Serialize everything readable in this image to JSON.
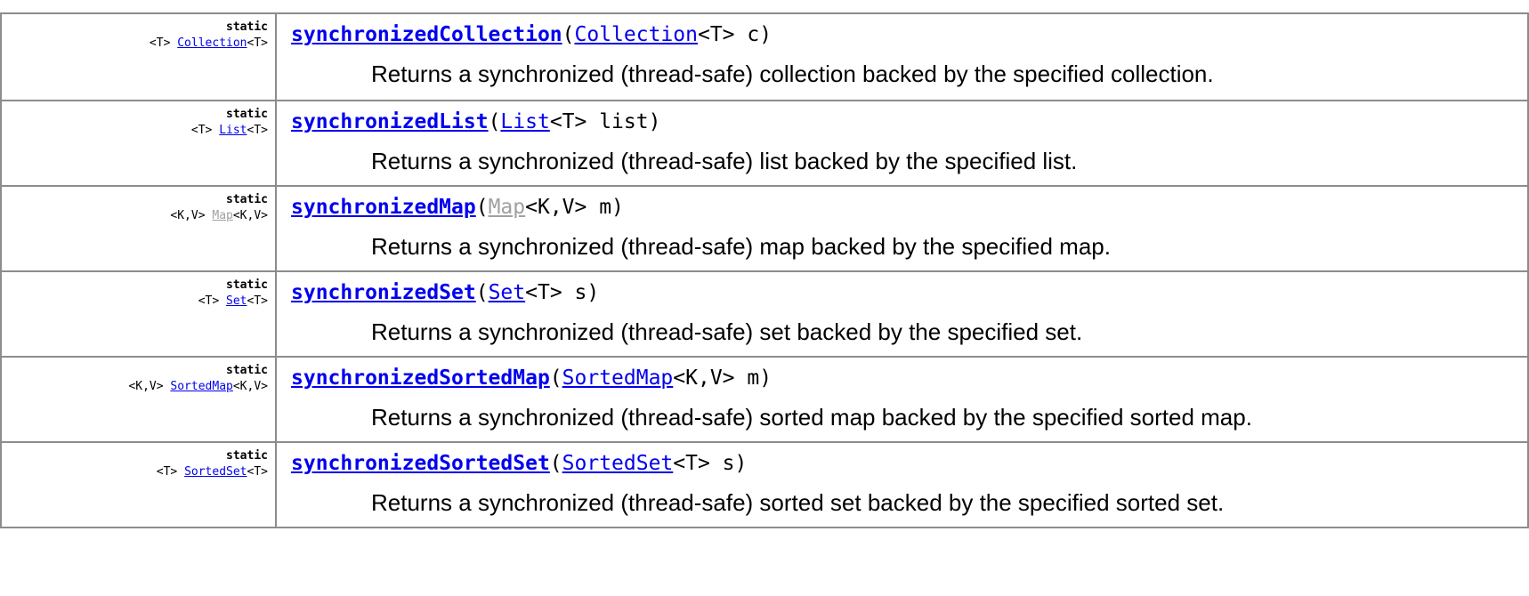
{
  "rows": [
    {
      "modifier": "static",
      "type_params": "<T>",
      "return_type": "Collection",
      "return_generics": "<T>",
      "method": "synchronizedCollection",
      "param_open": "(",
      "param_type": "Collection",
      "param_rest": "<T> c)",
      "description": "Returns a synchronized (thread-safe) collection backed by the specified collection."
    },
    {
      "modifier": "static",
      "type_params": "<T>",
      "return_type": "List",
      "return_generics": "<T>",
      "method": "synchronizedList",
      "param_open": "(",
      "param_type": "List",
      "param_rest": "<T> list)",
      "description": "Returns a synchronized (thread-safe) list backed by the specified list."
    },
    {
      "modifier": "static",
      "type_params": "<K,V>",
      "return_type": "Map",
      "return_generics": "<K,V>",
      "method": "synchronizedMap",
      "param_open": "(",
      "param_type": "Map",
      "param_rest": "<K,V> m)",
      "description": "Returns a synchronized (thread-safe) map backed by the specified map."
    },
    {
      "modifier": "static",
      "type_params": "<T>",
      "return_type": "Set",
      "return_generics": "<T>",
      "method": "synchronizedSet",
      "param_open": "(",
      "param_type": "Set",
      "param_rest": "<T> s)",
      "description": "Returns a synchronized (thread-safe) set backed by the specified set."
    },
    {
      "modifier": "static",
      "type_params": "<K,V>",
      "return_type": "SortedMap",
      "return_generics": "<K,V>",
      "method": "synchronizedSortedMap",
      "param_open": "(",
      "param_type": "SortedMap",
      "param_rest": "<K,V> m)",
      "description": "Returns a synchronized (thread-safe) sorted map backed by the specified sorted map."
    },
    {
      "modifier": "static",
      "type_params": "<T>",
      "return_type": "SortedSet",
      "return_generics": "<T>",
      "method": "synchronizedSortedSet",
      "param_open": "(",
      "param_type": "SortedSet",
      "param_rest": "<T> s)",
      "description": "Returns a synchronized (thread-safe) sorted set backed by the specified sorted set."
    }
  ]
}
